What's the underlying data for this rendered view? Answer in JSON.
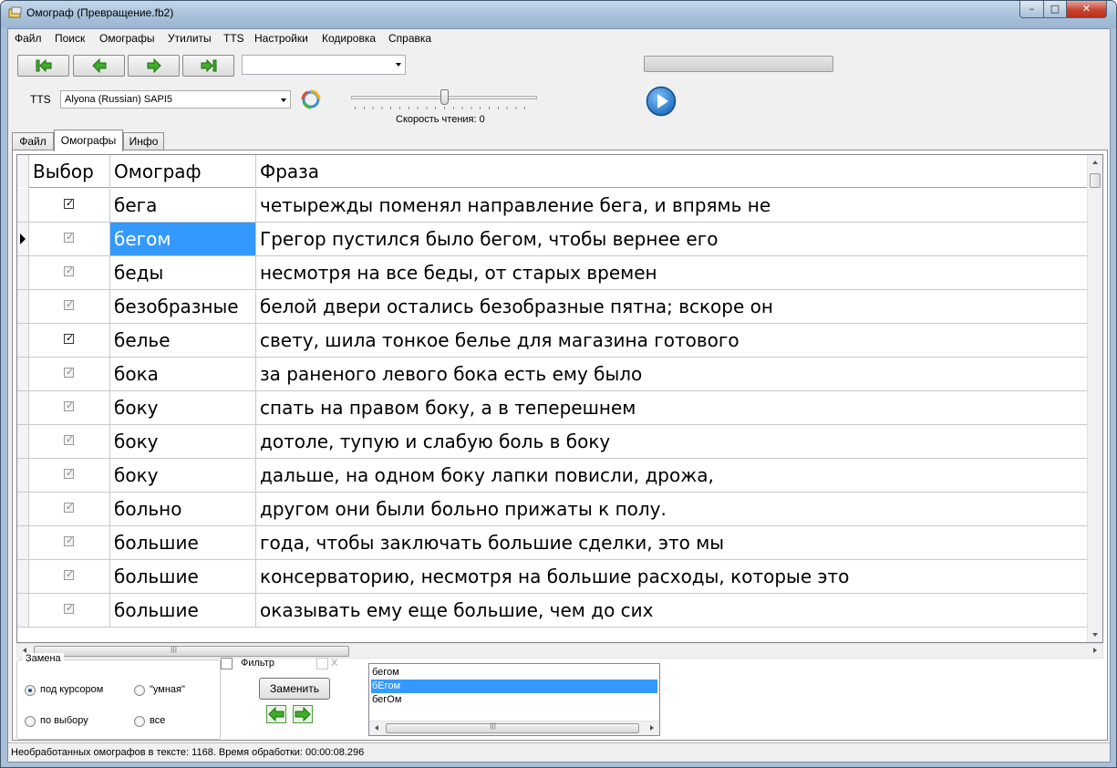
{
  "window": {
    "title": "Омограф (Превращение.fb2)",
    "min_glyph": "–",
    "max_glyph": "□",
    "close_glyph": "✕"
  },
  "menu": [
    "Файл",
    "Поиск",
    "Омографы",
    "Утилиты",
    "TTS",
    "Настройки",
    "Кодировка",
    "Справка"
  ],
  "toolbar": {
    "nav_icons": [
      "first-icon",
      "prev-icon",
      "next-icon",
      "last-icon"
    ],
    "combo_value": "",
    "progress_percent": 0
  },
  "tts": {
    "label": "TTS",
    "voice": "Alyona (Russian) SAPI5",
    "speed_label": "Скорость чтения: 0",
    "speed_value": 0,
    "speed_min": -10,
    "speed_max": 10
  },
  "tabs": [
    {
      "label": "Файл",
      "active": false
    },
    {
      "label": "Омографы",
      "active": true
    },
    {
      "label": "Инфо",
      "active": false
    }
  ],
  "grid": {
    "headers": [
      "Выбор",
      "Омограф",
      "Фраза"
    ],
    "rows": [
      {
        "checked": true,
        "enabled": true,
        "omograph": "бега",
        "phrase": "четырежды поменял направление бега, и впрямь не",
        "current": false
      },
      {
        "checked": true,
        "enabled": false,
        "omograph": "бегом",
        "phrase": "Грегор пустился было бегом, чтобы вернее его",
        "current": true
      },
      {
        "checked": true,
        "enabled": false,
        "omograph": "беды",
        "phrase": "несмотря на все беды, от старых времен",
        "current": false
      },
      {
        "checked": true,
        "enabled": false,
        "omograph": "безобразные",
        "phrase": "белой двери остались безобразные пятна; вскоре он",
        "current": false
      },
      {
        "checked": true,
        "enabled": true,
        "omograph": "белье",
        "phrase": "свету, шила тонкое белье для магазина готового",
        "current": false
      },
      {
        "checked": true,
        "enabled": false,
        "omograph": "бока",
        "phrase": "за раненого левого бока есть ему было",
        "current": false
      },
      {
        "checked": true,
        "enabled": false,
        "omograph": "боку",
        "phrase": "спать на правом боку, а в теперешнем",
        "current": false
      },
      {
        "checked": true,
        "enabled": false,
        "omograph": "боку",
        "phrase": "дотоле, тупую и слабую боль в боку",
        "current": false
      },
      {
        "checked": true,
        "enabled": false,
        "omograph": "боку",
        "phrase": "дальше, на одном боку лапки повисли, дрожа,",
        "current": false
      },
      {
        "checked": true,
        "enabled": false,
        "omograph": "больно",
        "phrase": "другом они были больно прижаты к полу.",
        "current": false
      },
      {
        "checked": true,
        "enabled": false,
        "omograph": "большие",
        "phrase": "года, чтобы заключать большие сделки, это мы",
        "current": false
      },
      {
        "checked": true,
        "enabled": false,
        "omograph": "большие",
        "phrase": "консерваторию, несмотря на большие расходы, которые это",
        "current": false
      },
      {
        "checked": true,
        "enabled": false,
        "omograph": "большие",
        "phrase": "оказывать ему еще большие, чем до сих",
        "current": false
      }
    ],
    "scroll_grip": "|||"
  },
  "replace": {
    "group_title": "Замена",
    "options": [
      {
        "label": "под курсором",
        "selected": true
      },
      {
        "label": "\"умная\"",
        "selected": false
      },
      {
        "label": "по выбору",
        "selected": false
      },
      {
        "label": "все",
        "selected": false
      }
    ],
    "filter_label": "Фильтр",
    "filter_checked": false,
    "x_label": "X",
    "x_checked": false,
    "replace_button": "Заменить"
  },
  "variants": {
    "items": [
      {
        "text": "бегом",
        "selected": false
      },
      {
        "text": "бЕгом",
        "selected": true
      },
      {
        "text": "бегОм",
        "selected": false
      }
    ],
    "scroll_grip": "|||"
  },
  "status": "Необработанных омографов в тексте: 1168. Время обработки: 00:00:08.296",
  "colors": {
    "selection": "#3399ff",
    "nav_arrow": "#3fae2a",
    "play": "#1f6fc4"
  }
}
